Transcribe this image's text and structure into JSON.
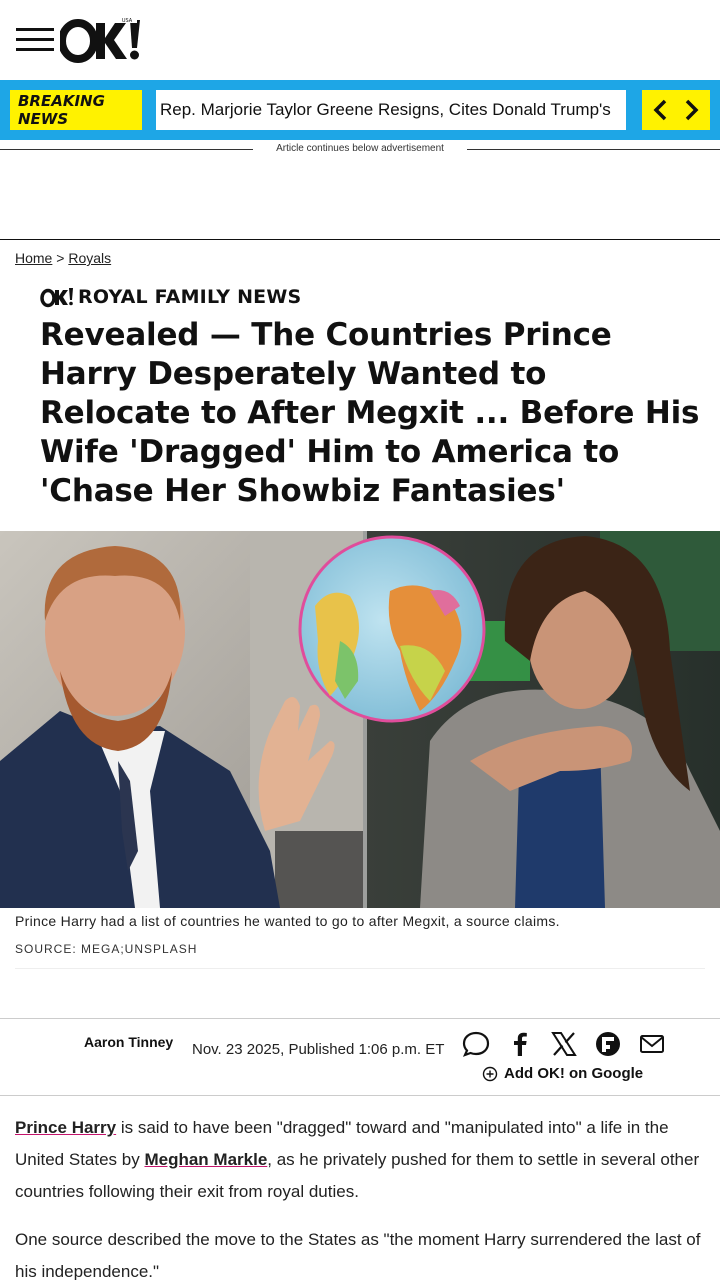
{
  "header": {
    "logo_text": "OK!",
    "logo_sub": "USA"
  },
  "breaking": {
    "label": "BREAKING NEWS",
    "headline": "Rep. Marjorie Taylor Greene Resigns, Cites Donald Trump's"
  },
  "ad_notice": "Article continues below advertisement",
  "breadcrumb": {
    "home": "Home",
    "separator": ">",
    "section": "Royals"
  },
  "article": {
    "section_label": "ROYAL FAMILY NEWS",
    "title": "Revealed — The Countries Prince Harry Desperately Wanted to Relocate to After Megxit ... Before His Wife 'Dragged' Him to America to 'Chase Her Showbiz Fantasies'",
    "caption": "Prince Harry had a list of countries he wanted to go to after Megxit, a source claims.",
    "source": "SOURCE: MEGA;UNSPLASH",
    "author": "Aaron Tinney",
    "date": "Nov. 23 2025, Published 1:06 p.m. ET",
    "add_google": "Add OK! on Google",
    "p1": {
      "link1": "Prince Harry",
      "text1": " is said to have been \"dragged\" toward and \"manipulated into\" a life in the United States by ",
      "link2": "Meghan Markle",
      "text2": ", as he privately pushed for them to settle in several other countries following their exit from royal duties."
    },
    "p2": "One source described the move to the States as \"the moment Harry surrendered the last of his independence.\""
  },
  "share_icons": [
    "comment-icon",
    "facebook-icon",
    "x-icon",
    "flipboard-icon",
    "email-icon"
  ],
  "colors": {
    "breaking_bar": "#1ea6e6",
    "breaking_label": "#fff200",
    "link_underline": "#c4136b"
  }
}
